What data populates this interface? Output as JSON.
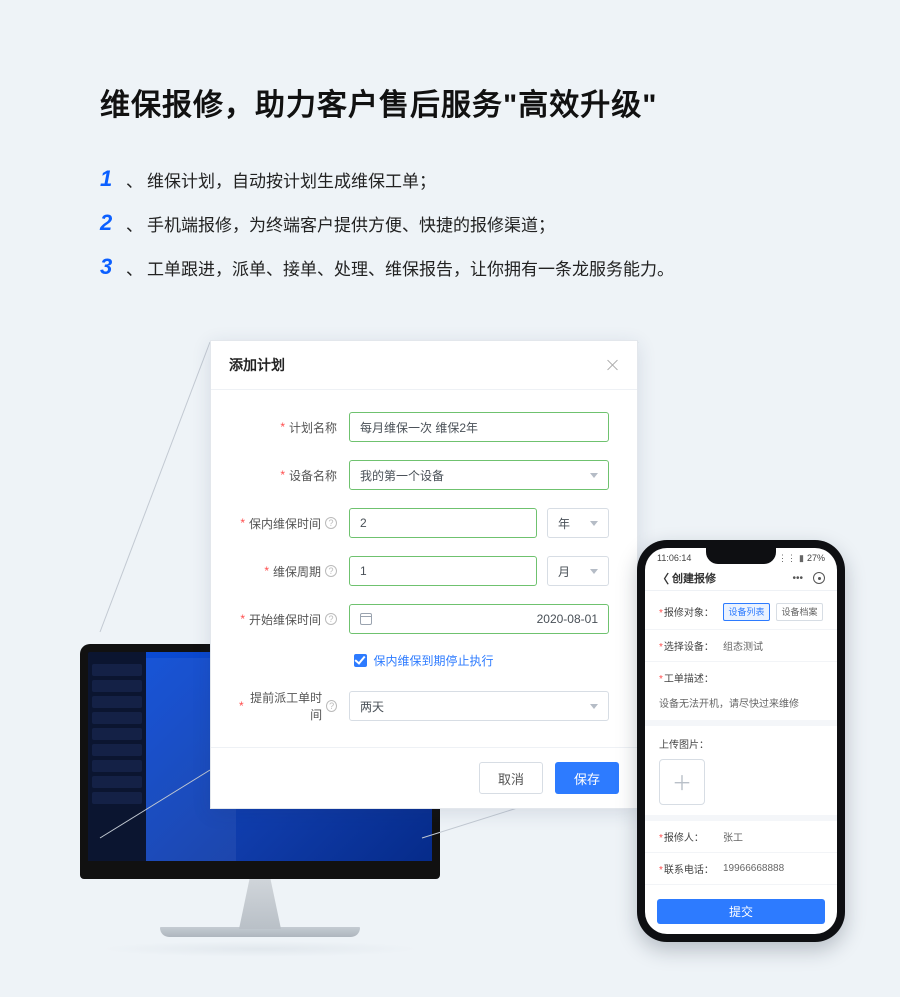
{
  "hero": {
    "title": "维保报修，助力客户售后服务\"高效升级\"",
    "bullets": [
      {
        "num": "1",
        "text": "维保计划，自动按计划生成维保工单；"
      },
      {
        "num": "2",
        "text": "手机端报修，为终端客户提供方便、快捷的报修渠道；"
      },
      {
        "num": "3",
        "text": "工单跟进，派单、接单、处理、维保报告，让你拥有一条龙服务能力。"
      }
    ],
    "sep": "、"
  },
  "modal": {
    "title": "添加计划",
    "fields": {
      "plan_name": {
        "label": "计划名称",
        "value": "每月维保一次  维保2年"
      },
      "device_name": {
        "label": "设备名称",
        "value": "我的第一个设备"
      },
      "warranty": {
        "label": "保内维保时间",
        "value": "2",
        "unit": "年"
      },
      "cycle": {
        "label": "维保周期",
        "value": "1",
        "unit": "月"
      },
      "start": {
        "label": "开始维保时间",
        "value": "2020-08-01"
      },
      "stop_check": {
        "label": "保内维保到期停止执行"
      },
      "lead": {
        "label": "提前派工单时间",
        "value": "两天"
      }
    },
    "buttons": {
      "cancel": "取消",
      "save": "保存"
    }
  },
  "phone": {
    "status_time": "11:06:14",
    "battery": "27%",
    "title": "创建报修",
    "rows": {
      "target": {
        "label": "报修对象：",
        "tabs": [
          "设备列表",
          "设备档案"
        ],
        "active": 0
      },
      "device": {
        "label": "选择设备：",
        "value": "组态测试"
      },
      "desc_lab": {
        "label": "工单描述："
      },
      "desc_val": "设备无法开机，请尽快过来维修",
      "upload_lab": "上传图片：",
      "reporter": {
        "label": "报修人：",
        "value": "张工"
      },
      "phoneno": {
        "label": "联系电话：",
        "value": "19966668888"
      },
      "submit": "提交"
    }
  }
}
